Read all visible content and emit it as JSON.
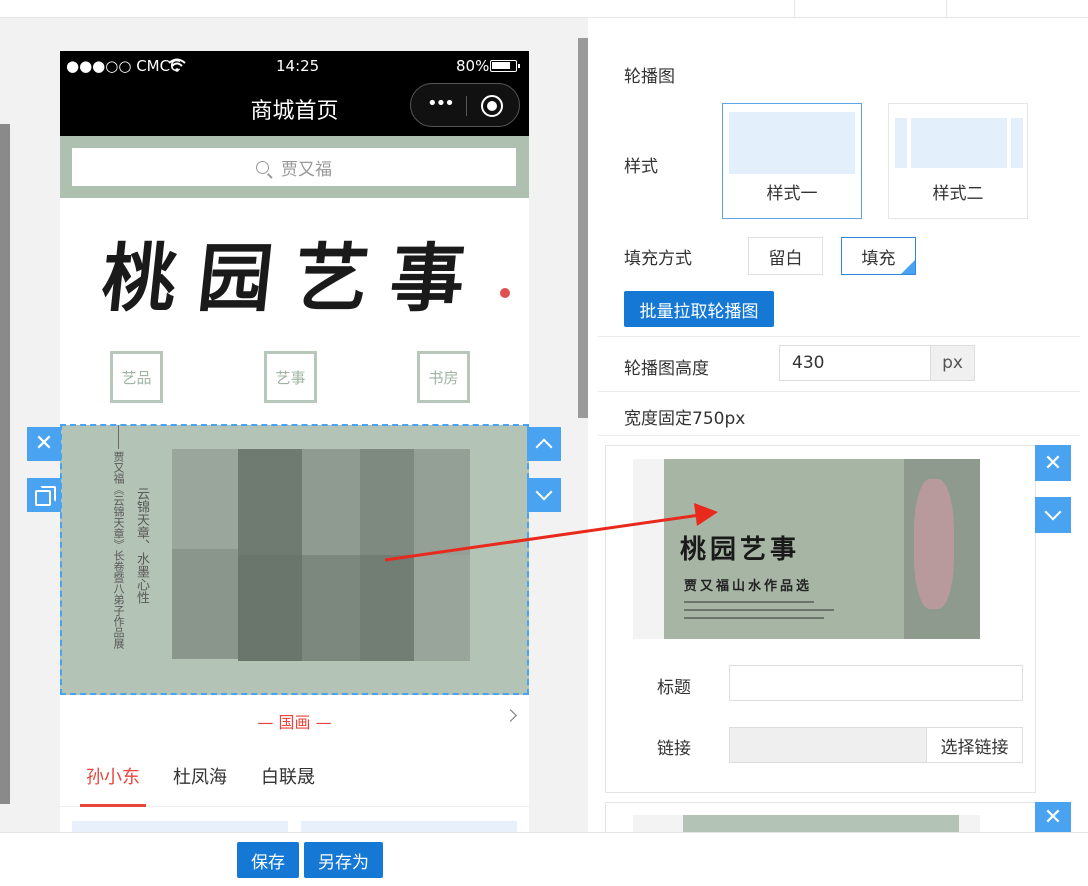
{
  "phone": {
    "status": {
      "carrier": "●●●○○ CMCC",
      "time": "14:25",
      "battery": "80%"
    },
    "nav_title": "商城首页",
    "search_placeholder": "贾又福",
    "logo_text": "桃园艺事",
    "categories": [
      {
        "label": "艺品"
      },
      {
        "label": "艺事"
      },
      {
        "label": "书房"
      }
    ],
    "banner": {
      "line1": "云锦天章、水墨心性",
      "line2": "贾又福《云锦天章》长卷暨八弟子作品展"
    },
    "section_title": "— 国画 —",
    "tabs": [
      {
        "label": "孙小东",
        "active": true
      },
      {
        "label": "杜凤海",
        "active": false
      },
      {
        "label": "白联晟",
        "active": false
      }
    ]
  },
  "bottom": {
    "save": "保存",
    "save_as": "另存为"
  },
  "settings": {
    "heading": "轮播图",
    "style_label": "样式",
    "styles": [
      {
        "name": "样式一",
        "active": true
      },
      {
        "name": "样式二",
        "active": false
      }
    ],
    "fill_label": "填充方式",
    "fill_options": [
      {
        "name": "留白",
        "active": false
      },
      {
        "name": "填充",
        "active": true
      }
    ],
    "batch_button": "批量拉取轮播图",
    "height_label": "轮播图高度",
    "height_value": "430",
    "height_unit": "px",
    "width_note": "宽度固定750px",
    "item": {
      "thumb_title": "桃园艺事",
      "thumb_subtitle": "贾又福山水作品选",
      "title_label": "标题",
      "title_value": "",
      "link_label": "链接",
      "link_value": "",
      "choose_link": "选择链接"
    }
  },
  "colors": {
    "accent": "#1478d4",
    "handle": "#4aa3f0",
    "tab_active": "#e8453c",
    "banner_bg": "#b3c3b5",
    "arrow": "#e8291c"
  }
}
